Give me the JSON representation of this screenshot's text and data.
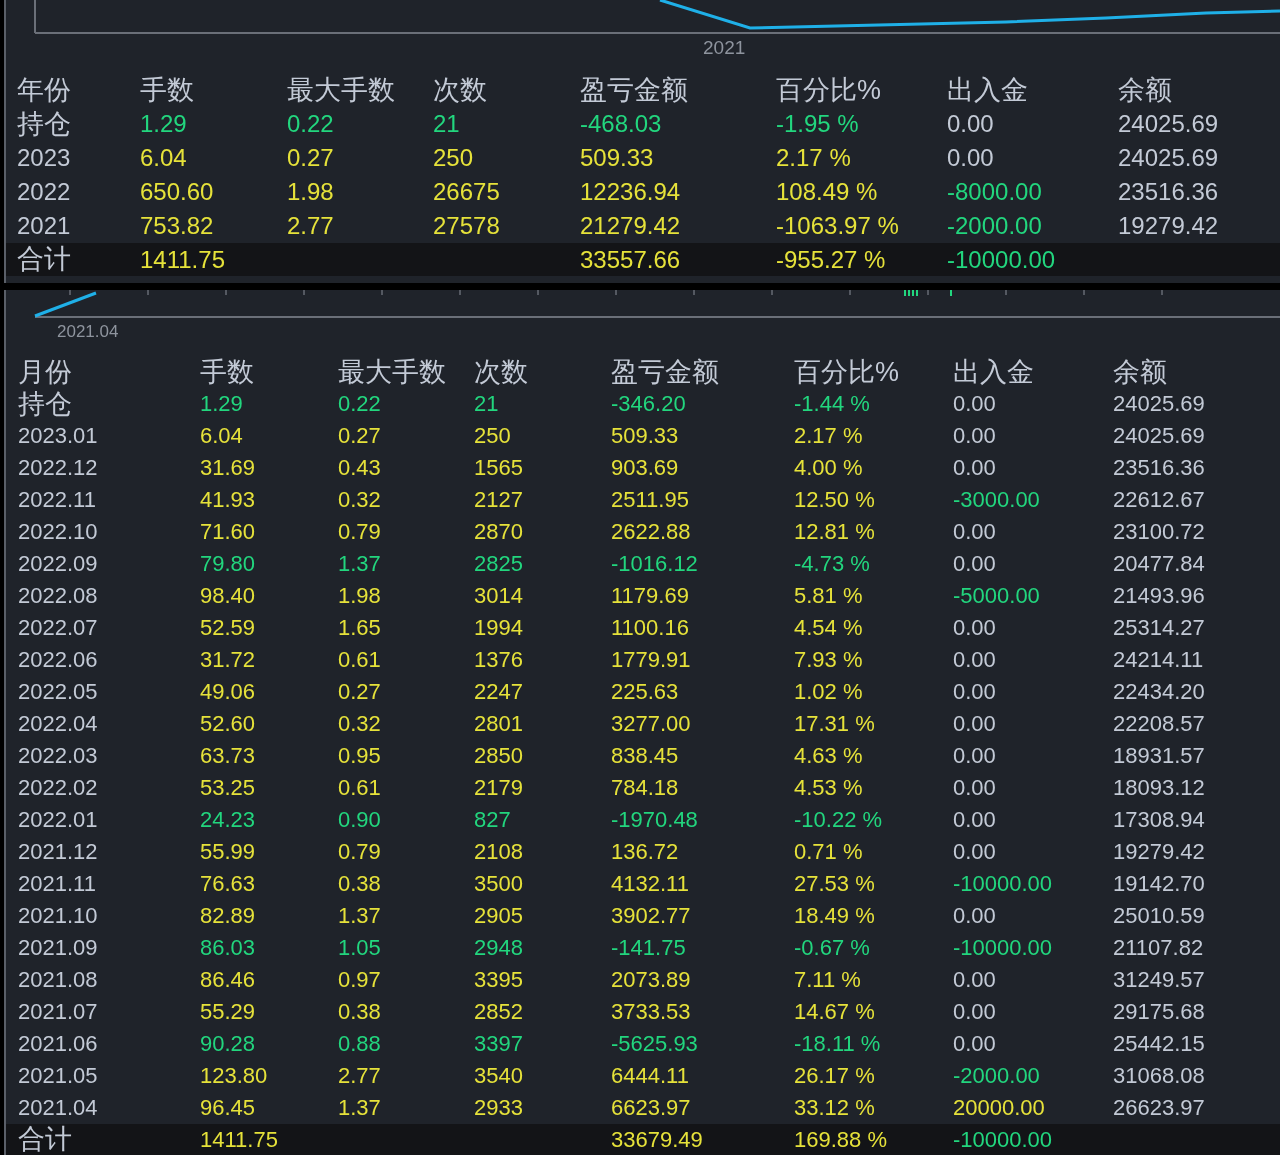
{
  "year_panel": {
    "axis_label": "2021",
    "columns": [
      "年份",
      "手数",
      "最大手数",
      "次数",
      "盈亏金额",
      "百分比%",
      "出入金",
      "余额"
    ],
    "rows": [
      {
        "cells": [
          "持仓",
          "1.29",
          "0.22",
          "21",
          "-468.03",
          "-1.95 %",
          "0.00",
          "24025.69"
        ],
        "loss": true,
        "withdrawal": false,
        "deposit_made": false
      },
      {
        "cells": [
          "2023",
          "6.04",
          "0.27",
          "250",
          "509.33",
          "2.17 %",
          "0.00",
          "24025.69"
        ],
        "loss": false,
        "withdrawal": false,
        "deposit_made": false
      },
      {
        "cells": [
          "2022",
          "650.60",
          "1.98",
          "26675",
          "12236.94",
          "108.49 %",
          "-8000.00",
          "23516.36"
        ],
        "loss": false,
        "withdrawal": true,
        "deposit_made": false
      },
      {
        "cells": [
          "2021",
          "753.82",
          "2.77",
          "27578",
          "21279.42",
          "-1063.97 %",
          "-2000.00",
          "19279.42"
        ],
        "loss": false,
        "withdrawal": true,
        "deposit_made": false
      }
    ],
    "total": {
      "label": "合计",
      "lots": "1411.75",
      "profit": "33557.66",
      "percent": "-955.27 %",
      "flow_amount": "-10000.00",
      "loss": false,
      "withdrawal": true,
      "deposit_made": false
    }
  },
  "month_panel": {
    "axis_label": "2021.04",
    "columns": [
      "月份",
      "手数",
      "最大手数",
      "次数",
      "盈亏金额",
      "百分比%",
      "出入金",
      "余额"
    ],
    "rows": [
      {
        "cells": [
          "持仓",
          "1.29",
          "0.22",
          "21",
          "-346.20",
          "-1.44 %",
          "0.00",
          "24025.69"
        ],
        "loss": true,
        "withdrawal": false,
        "deposit_made": false
      },
      {
        "cells": [
          "2023.01",
          "6.04",
          "0.27",
          "250",
          "509.33",
          "2.17 %",
          "0.00",
          "24025.69"
        ],
        "loss": false,
        "withdrawal": false,
        "deposit_made": false
      },
      {
        "cells": [
          "2022.12",
          "31.69",
          "0.43",
          "1565",
          "903.69",
          "4.00 %",
          "0.00",
          "23516.36"
        ],
        "loss": false,
        "withdrawal": false,
        "deposit_made": false
      },
      {
        "cells": [
          "2022.11",
          "41.93",
          "0.32",
          "2127",
          "2511.95",
          "12.50 %",
          "-3000.00",
          "22612.67"
        ],
        "loss": false,
        "withdrawal": true,
        "deposit_made": false
      },
      {
        "cells": [
          "2022.10",
          "71.60",
          "0.79",
          "2870",
          "2622.88",
          "12.81 %",
          "0.00",
          "23100.72"
        ],
        "loss": false,
        "withdrawal": false,
        "deposit_made": false
      },
      {
        "cells": [
          "2022.09",
          "79.80",
          "1.37",
          "2825",
          "-1016.12",
          "-4.73 %",
          "0.00",
          "20477.84"
        ],
        "loss": true,
        "withdrawal": false,
        "deposit_made": false
      },
      {
        "cells": [
          "2022.08",
          "98.40",
          "1.98",
          "3014",
          "1179.69",
          "5.81 %",
          "-5000.00",
          "21493.96"
        ],
        "loss": false,
        "withdrawal": true,
        "deposit_made": false
      },
      {
        "cells": [
          "2022.07",
          "52.59",
          "1.65",
          "1994",
          "1100.16",
          "4.54 %",
          "0.00",
          "25314.27"
        ],
        "loss": false,
        "withdrawal": false,
        "deposit_made": false
      },
      {
        "cells": [
          "2022.06",
          "31.72",
          "0.61",
          "1376",
          "1779.91",
          "7.93 %",
          "0.00",
          "24214.11"
        ],
        "loss": false,
        "withdrawal": false,
        "deposit_made": false
      },
      {
        "cells": [
          "2022.05",
          "49.06",
          "0.27",
          "2247",
          "225.63",
          "1.02 %",
          "0.00",
          "22434.20"
        ],
        "loss": false,
        "withdrawal": false,
        "deposit_made": false
      },
      {
        "cells": [
          "2022.04",
          "52.60",
          "0.32",
          "2801",
          "3277.00",
          "17.31 %",
          "0.00",
          "22208.57"
        ],
        "loss": false,
        "withdrawal": false,
        "deposit_made": false
      },
      {
        "cells": [
          "2022.03",
          "63.73",
          "0.95",
          "2850",
          "838.45",
          "4.63 %",
          "0.00",
          "18931.57"
        ],
        "loss": false,
        "withdrawal": false,
        "deposit_made": false
      },
      {
        "cells": [
          "2022.02",
          "53.25",
          "0.61",
          "2179",
          "784.18",
          "4.53 %",
          "0.00",
          "18093.12"
        ],
        "loss": false,
        "withdrawal": false,
        "deposit_made": false
      },
      {
        "cells": [
          "2022.01",
          "24.23",
          "0.90",
          "827",
          "-1970.48",
          "-10.22 %",
          "0.00",
          "17308.94"
        ],
        "loss": true,
        "withdrawal": false,
        "deposit_made": false
      },
      {
        "cells": [
          "2021.12",
          "55.99",
          "0.79",
          "2108",
          "136.72",
          "0.71 %",
          "0.00",
          "19279.42"
        ],
        "loss": false,
        "withdrawal": false,
        "deposit_made": false
      },
      {
        "cells": [
          "2021.11",
          "76.63",
          "0.38",
          "3500",
          "4132.11",
          "27.53 %",
          "-10000.00",
          "19142.70"
        ],
        "loss": false,
        "withdrawal": true,
        "deposit_made": false
      },
      {
        "cells": [
          "2021.10",
          "82.89",
          "1.37",
          "2905",
          "3902.77",
          "18.49 %",
          "0.00",
          "25010.59"
        ],
        "loss": false,
        "withdrawal": false,
        "deposit_made": false
      },
      {
        "cells": [
          "2021.09",
          "86.03",
          "1.05",
          "2948",
          "-141.75",
          "-0.67 %",
          "-10000.00",
          "21107.82"
        ],
        "loss": true,
        "withdrawal": true,
        "deposit_made": false
      },
      {
        "cells": [
          "2021.08",
          "86.46",
          "0.97",
          "3395",
          "2073.89",
          "7.11 %",
          "0.00",
          "31249.57"
        ],
        "loss": false,
        "withdrawal": false,
        "deposit_made": false
      },
      {
        "cells": [
          "2021.07",
          "55.29",
          "0.38",
          "2852",
          "3733.53",
          "14.67 %",
          "0.00",
          "29175.68"
        ],
        "loss": false,
        "withdrawal": false,
        "deposit_made": false
      },
      {
        "cells": [
          "2021.06",
          "90.28",
          "0.88",
          "3397",
          "-5625.93",
          "-18.11 %",
          "0.00",
          "25442.15"
        ],
        "loss": true,
        "withdrawal": false,
        "deposit_made": false
      },
      {
        "cells": [
          "2021.05",
          "123.80",
          "2.77",
          "3540",
          "6444.11",
          "26.17 %",
          "-2000.00",
          "31068.08"
        ],
        "loss": false,
        "withdrawal": true,
        "deposit_made": false
      },
      {
        "cells": [
          "2021.04",
          "96.45",
          "1.37",
          "2933",
          "6623.97",
          "33.12 %",
          "20000.00",
          "26623.97"
        ],
        "loss": false,
        "withdrawal": false,
        "deposit_made": true
      }
    ],
    "total": {
      "label": "合计",
      "lots": "1411.75",
      "profit": "33679.49",
      "percent": "169.88 %",
      "flow_amount": "-10000.00",
      "loss": false,
      "withdrawal": true,
      "deposit_made": false
    }
  }
}
